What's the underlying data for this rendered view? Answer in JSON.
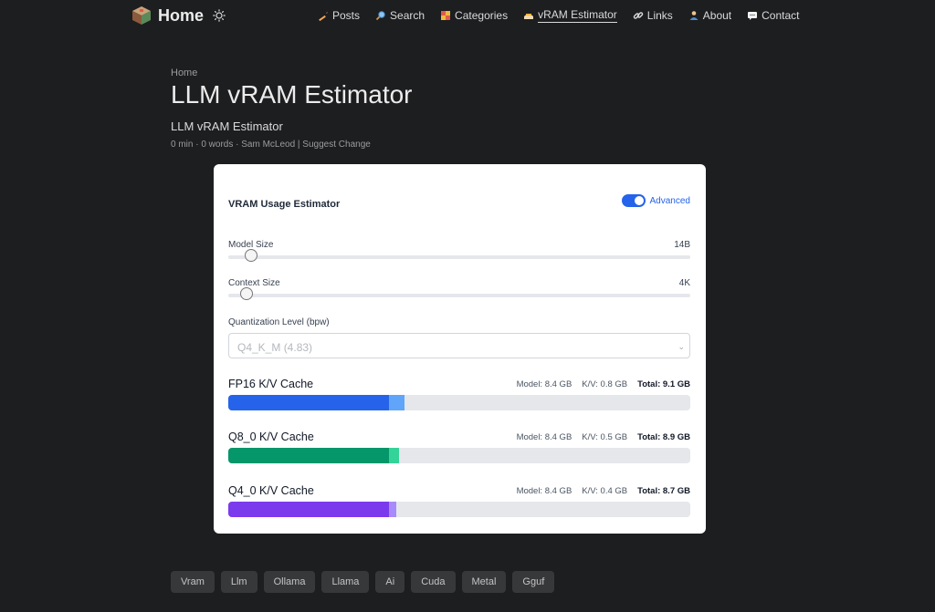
{
  "header": {
    "home_label": "Home",
    "nav": [
      {
        "label": "Posts",
        "icon": "pencil-icon",
        "active": false
      },
      {
        "label": "Search",
        "icon": "magnifier-icon",
        "active": false
      },
      {
        "label": "Categories",
        "icon": "categories-icon",
        "active": false
      },
      {
        "label": "vRAM Estimator",
        "icon": "estimator-icon",
        "active": true
      },
      {
        "label": "Links",
        "icon": "link-icon",
        "active": false
      },
      {
        "label": "About",
        "icon": "person-icon",
        "active": false
      },
      {
        "label": "Contact",
        "icon": "chat-icon",
        "active": false
      }
    ]
  },
  "page": {
    "breadcrumb": "Home",
    "title": "LLM vRAM Estimator",
    "subtitle": "LLM vRAM Estimator",
    "meta": "0 min · 0 words · Sam McLeod | Suggest Change"
  },
  "estimator": {
    "title": "VRAM Usage Estimator",
    "advanced_label": "Advanced",
    "advanced_on": true,
    "model_size": {
      "label": "Model Size",
      "value": "14B",
      "level": 0.03
    },
    "context_size": {
      "label": "Context Size",
      "value": "4K",
      "level": 0.02
    },
    "quantization": {
      "label": "Quantization Level (bpw)",
      "value": "Q4_K_M (4.83)"
    },
    "caches": [
      {
        "name": "FP16 K/V Cache",
        "model": "Model: 8.4 GB",
        "kv": "K/V: 0.8 GB",
        "total": "Total: 9.1 GB",
        "model_frac": 0.348,
        "kv_frac": 0.033,
        "color": "#2563eb",
        "kv_color": "#60a5fa"
      },
      {
        "name": "Q8_0 K/V Cache",
        "model": "Model: 8.4 GB",
        "kv": "K/V: 0.5 GB",
        "total": "Total: 8.9 GB",
        "model_frac": 0.348,
        "kv_frac": 0.021,
        "color": "#059669",
        "kv_color": "#34d399"
      },
      {
        "name": "Q4_0 K/V Cache",
        "model": "Model: 8.4 GB",
        "kv": "K/V: 0.4 GB",
        "total": "Total: 8.7 GB",
        "model_frac": 0.348,
        "kv_frac": 0.016,
        "color": "#7c3aed",
        "kv_color": "#a78bfa"
      }
    ]
  },
  "tags": [
    "Vram",
    "Llm",
    "Ollama",
    "Llama",
    "Ai",
    "Cuda",
    "Metal",
    "Gguf"
  ]
}
